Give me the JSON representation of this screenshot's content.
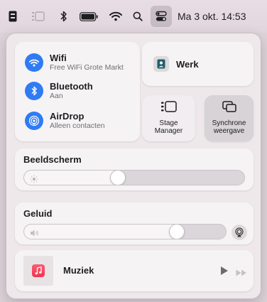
{
  "menubar": {
    "icons": [
      "app-icon",
      "stage-manager-icon",
      "bluetooth-icon",
      "battery-icon",
      "wifi-icon",
      "spotlight-icon",
      "control-center-icon"
    ],
    "clock": "Ma 3 okt. 14:53"
  },
  "connectivity": {
    "wifi": {
      "title": "Wifi",
      "subtitle": "Free WiFi Grote Markt",
      "icon": "wifi-icon"
    },
    "bluetooth": {
      "title": "Bluetooth",
      "subtitle": "Aan",
      "icon": "bluetooth-icon"
    },
    "airdrop": {
      "title": "AirDrop",
      "subtitle": "Alleen contacten",
      "icon": "airdrop-icon"
    },
    "accent_color": "#2f7bf4"
  },
  "focus": {
    "label": "Werk",
    "icon": "person-badge-icon"
  },
  "stage_manager": {
    "label": "Stage Manager",
    "icon": "stage-manager-icon"
  },
  "screen_mirroring": {
    "label": "Synchrone weergave",
    "icon": "screen-mirroring-icon"
  },
  "display": {
    "title": "Beeldscherm",
    "level": 0.42,
    "icon": "sun-icon"
  },
  "sound": {
    "title": "Geluid",
    "level": 0.78,
    "icon": "speaker-icon",
    "output_icon": "airplay-audio-icon"
  },
  "now_playing": {
    "app": "Muziek",
    "icon": "music-note-icon",
    "controls": [
      "play-icon",
      "fast-forward-icon"
    ]
  }
}
